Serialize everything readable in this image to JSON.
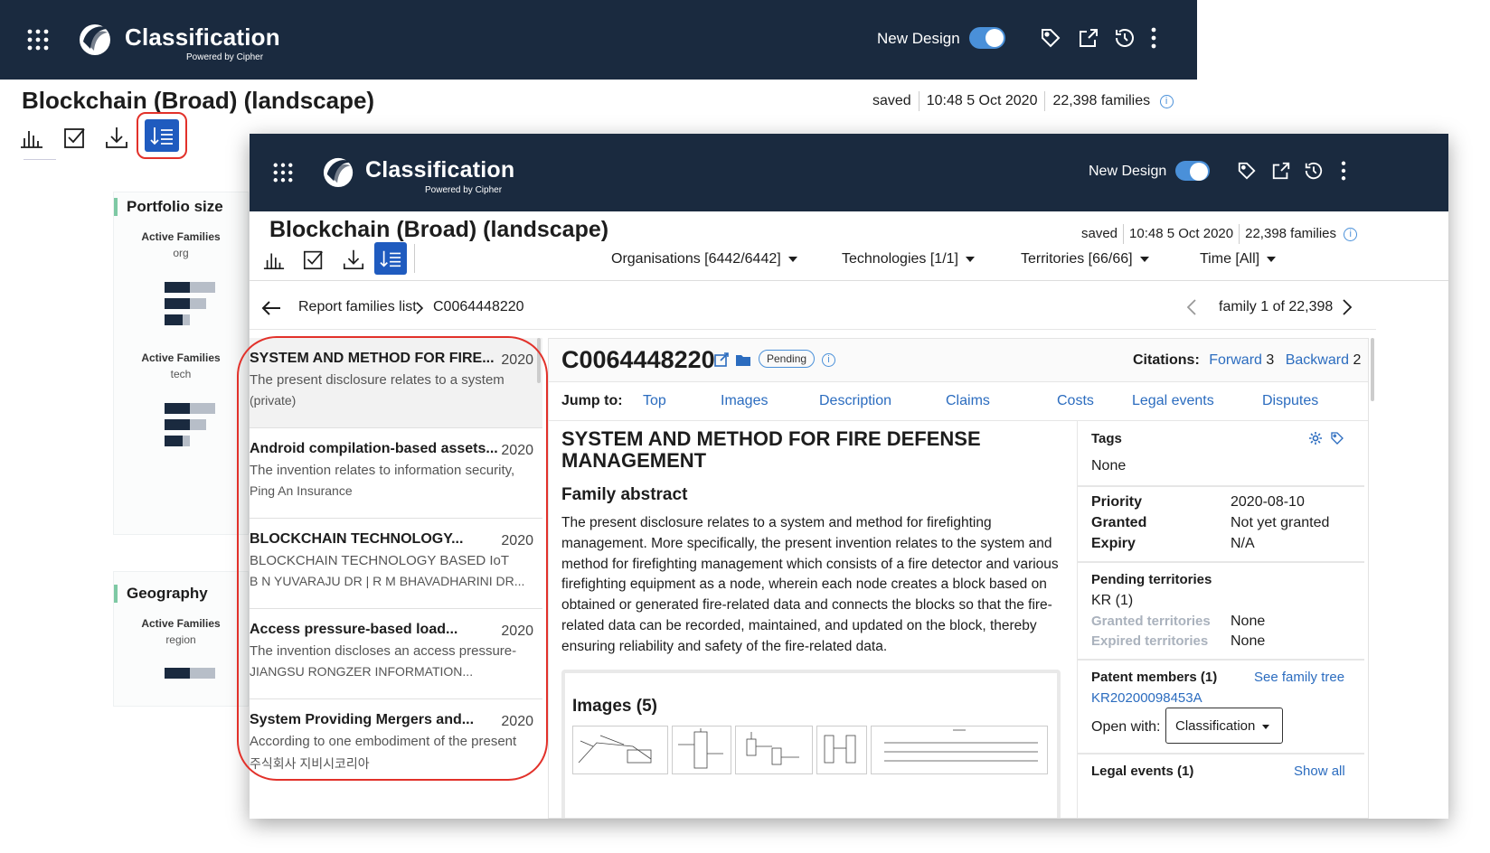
{
  "app": {
    "title": "Classification",
    "subtitle": "Powered by Cipher",
    "new_design_label": "New Design"
  },
  "report": {
    "title": "Blockchain (Broad) (landscape)",
    "status": "saved",
    "timestamp": "10:48 5 Oct 2020",
    "families": "22,398 families"
  },
  "icons": [
    "grid-icon",
    "logo-icon",
    "tag-icon",
    "export-icon",
    "history-icon",
    "more-icon",
    "chart-icon",
    "checkbox-icon",
    "download-icon",
    "sort-list-icon",
    "info-icon",
    "back-arrow-icon",
    "chevron-right-icon",
    "chevron-left-icon",
    "edit-icon",
    "folder-icon",
    "gear-icon"
  ],
  "back_panels": {
    "portfolio_title": "Portfolio size",
    "active_families": "Active Families",
    "org": "org",
    "tech": "tech",
    "geography_title": "Geography",
    "region": "region"
  },
  "filters": {
    "organisations": "Organisations [6442/6442]",
    "technologies": "Technologies [1/1]",
    "territories": "Territories [66/66]",
    "time": "Time [All]"
  },
  "breadcrumb": {
    "list": "Report families list",
    "current": "C0064448220",
    "pager": "family 1 of 22,398"
  },
  "families_list": [
    {
      "title": "SYSTEM AND METHOD FOR FIRE...",
      "year": "2020",
      "abstract": "The present disclosure relates to a system",
      "owner": "(private)"
    },
    {
      "title": "Android compilation-based assets...",
      "year": "2020",
      "abstract": "The invention relates to information security,",
      "owner": "Ping An Insurance"
    },
    {
      "title": "BLOCKCHAIN TECHNOLOGY...",
      "year": "2020",
      "abstract": "BLOCKCHAIN TECHNOLOGY BASED IoT",
      "owner": "B N YUVARAJU DR | R M BHAVADHARINI DR..."
    },
    {
      "title": "Access pressure-based load...",
      "year": "2020",
      "abstract": "The invention discloses an access pressure-",
      "owner": "JIANGSU RONGZER INFORMATION..."
    },
    {
      "title": "System Providing Mergers and...",
      "year": "2020",
      "abstract": "According to one embodiment of the present",
      "owner": "주식회사 지비시코리아"
    }
  ],
  "family": {
    "id": "C0064448220",
    "status": "Pending",
    "citations_label": "Citations:",
    "forward_label": "Forward",
    "forward_count": "3",
    "backward_label": "Backward",
    "backward_count": "2",
    "jump_to": "Jump to:",
    "jump_links": [
      "Top",
      "Images",
      "Description",
      "Claims",
      "Costs",
      "Legal events",
      "Disputes"
    ],
    "doc_title": "SYSTEM AND METHOD FOR FIRE DEFENSE MANAGEMENT",
    "abstract_heading": "Family abstract",
    "abstract_lines": [
      "The present disclosure relates to a system and method for firefighting",
      "management. More specifically, the present invention relates to the system and",
      "method for firefighting management which consists of a fire detector and various",
      "firefighting equipment as a node, wherein each node creates a block based on",
      "obtained or generated fire-related data and connects the blocks so that the fire-",
      "related data can be recorded, maintained, and updated on the block, thereby",
      "ensuring reliability and safety of the fire-related data."
    ],
    "images_heading": "Images (5)"
  },
  "sidebar": {
    "tags_label": "Tags",
    "tags_value": "None",
    "priority_label": "Priority",
    "priority_value": "2020-08-10",
    "granted_label": "Granted",
    "granted_value": "Not yet granted",
    "expiry_label": "Expiry",
    "expiry_value": "N/A",
    "pending_territories_label": "Pending territories",
    "pending_territories_value": "KR (1)",
    "granted_territories_label": "Granted territories",
    "granted_territories_value": "None",
    "expired_territories_label": "Expired territories",
    "expired_territories_value": "None",
    "members_label": "Patent members (1)",
    "family_tree_link": "See family tree",
    "member_link": "KR20200098453A",
    "open_with_label": "Open with:",
    "open_with_value": "Classification",
    "legal_events_label": "Legal events (1)",
    "show_all_link": "Show all"
  },
  "colors": {
    "header_bg": "#1a2a3f",
    "accent": "#1f5bbf",
    "link": "#2b6cbf",
    "highlight": "#e2312a",
    "toggle": "#4a90d9"
  }
}
